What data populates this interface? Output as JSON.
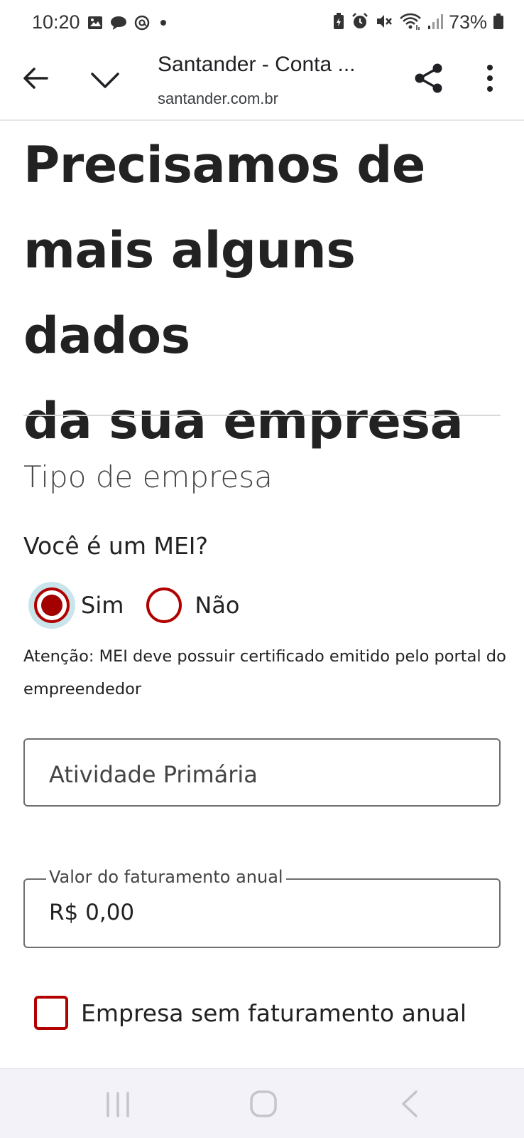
{
  "status_bar": {
    "time": "10:20",
    "battery_percent": "73%",
    "left_icons": [
      "gallery-icon",
      "chat-icon",
      "threads-icon",
      "dot-icon"
    ],
    "right_icons": [
      "battery-saver-icon",
      "alarm-icon",
      "mute-icon",
      "wifi-icon",
      "signal-icon",
      "battery-icon"
    ]
  },
  "browser": {
    "page_title": "Santander - Conta ...",
    "url": "santander.com.br"
  },
  "form": {
    "heading_lines": [
      "Precisamos de",
      "mais alguns dados",
      "da sua empresa"
    ],
    "section_title": "Tipo de empresa",
    "question": "Você é um MEI?",
    "options": [
      {
        "label": "Sim",
        "selected": true
      },
      {
        "label": "Não",
        "selected": false
      }
    ],
    "notice": " Atenção: MEI deve possuir certificado emitido pelo portal do empreendedor",
    "activity_placeholder": "Atividade Primária",
    "revenue_label": "Valor do faturamento anual",
    "revenue_value": "R$ 0,00",
    "no_revenue_label": "Empresa sem faturamento anual",
    "no_revenue_checked": false
  },
  "colors": {
    "accent": "#b20000",
    "focus_ring": "#c8e5ec",
    "text": "#222222",
    "navbar_bg": "#f2f2f8"
  }
}
